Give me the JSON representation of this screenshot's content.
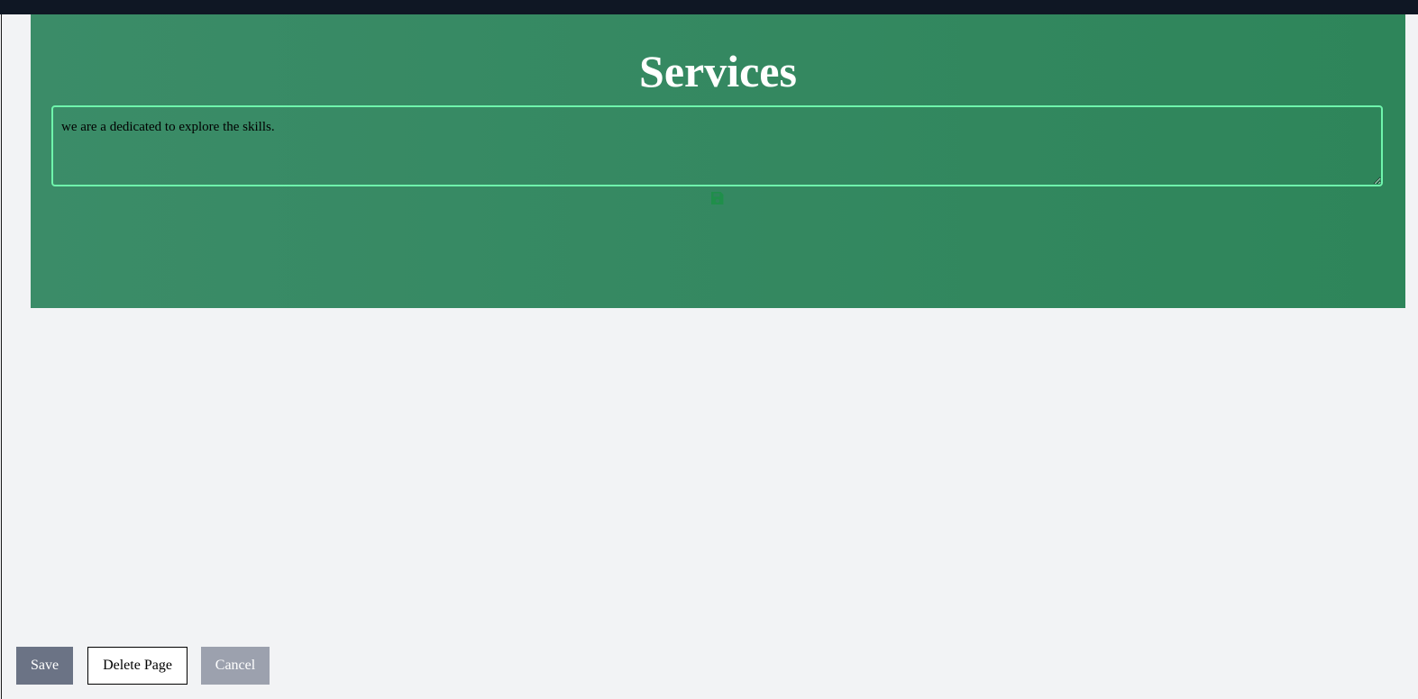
{
  "section": {
    "title": "Services",
    "description": "we are a dedicated to explore the skills."
  },
  "icons": {
    "save": "save-icon"
  },
  "colors": {
    "top_bar": "#0f1724",
    "section_bg_start": "#3b8c68",
    "section_bg_end": "#2e855a",
    "textarea_border": "#6ff5ac",
    "save_icon": "#1f8f4a"
  },
  "actions": {
    "save_label": "Save",
    "delete_label": "Delete Page",
    "cancel_label": "Cancel"
  }
}
